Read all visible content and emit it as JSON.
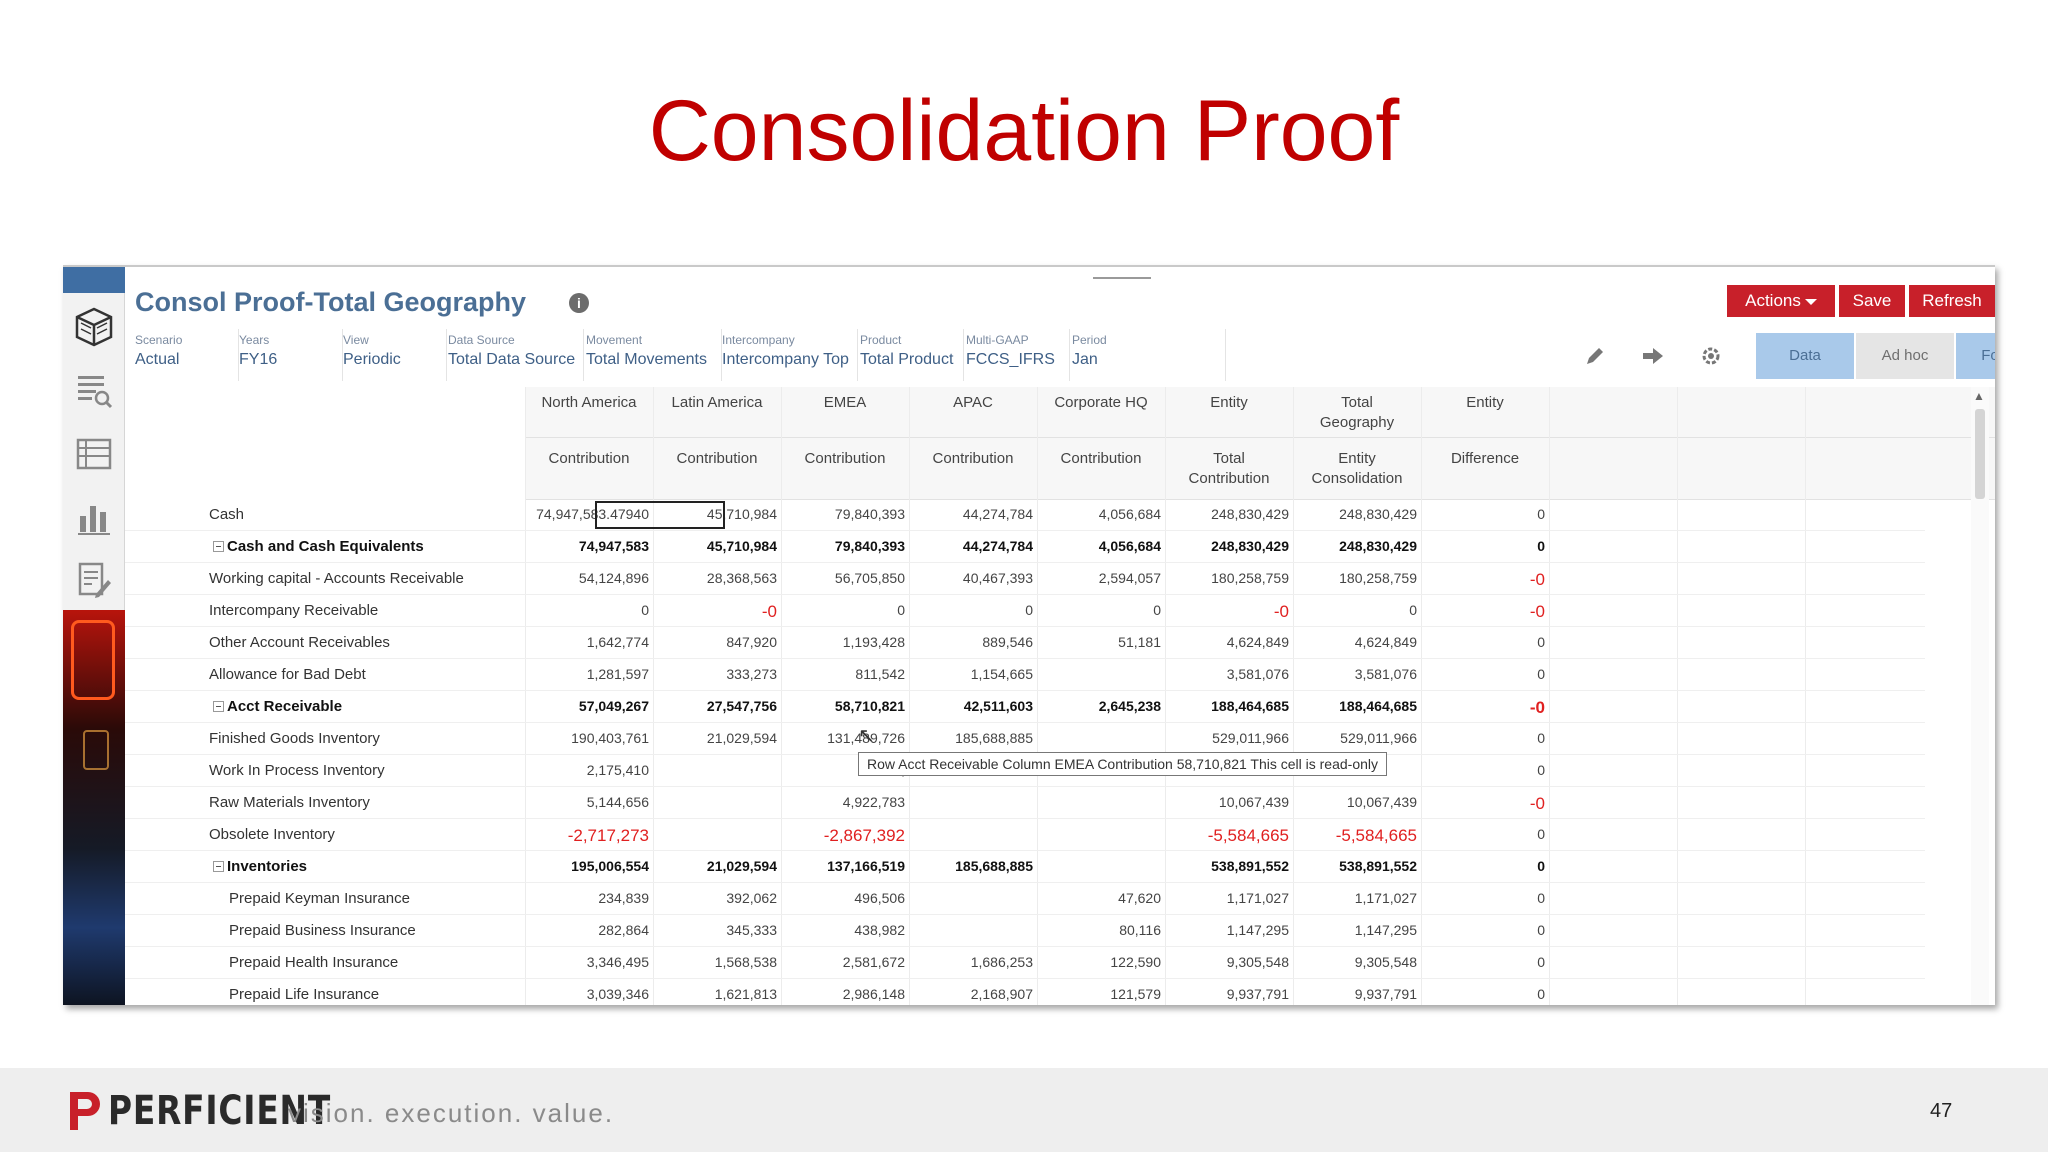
{
  "slide": {
    "title": "Consolidation Proof",
    "page_number": "47"
  },
  "form": {
    "title": "Consol Proof-Total Geography",
    "info_glyph": "i",
    "actions_label": "Actions",
    "save_label": "Save",
    "refresh_label": "Refresh",
    "tabs": {
      "data": "Data",
      "adhoc": "Ad hoc",
      "format": "Format"
    }
  },
  "pov": [
    {
      "label": "Scenario",
      "value": "Actual"
    },
    {
      "label": "Years",
      "value": "FY16"
    },
    {
      "label": "View",
      "value": "Periodic"
    },
    {
      "label": "Data Source",
      "value": "Total Data Source"
    },
    {
      "label": "Movement",
      "value": "Total Movements"
    },
    {
      "label": "Intercompany",
      "value": "Intercompany Top"
    },
    {
      "label": "Product",
      "value": "Total Product"
    },
    {
      "label": "Multi-GAAP",
      "value": "FCCS_IFRS"
    },
    {
      "label": "Period",
      "value": "Jan"
    }
  ],
  "columns": [
    {
      "h1": "North America",
      "h1b": "",
      "h2": "Contribution",
      "h2b": ""
    },
    {
      "h1": "Latin America",
      "h1b": "",
      "h2": "Contribution",
      "h2b": ""
    },
    {
      "h1": "EMEA",
      "h1b": "",
      "h2": "Contribution",
      "h2b": ""
    },
    {
      "h1": "APAC",
      "h1b": "",
      "h2": "Contribution",
      "h2b": ""
    },
    {
      "h1": "Corporate HQ",
      "h1b": "",
      "h2": "Contribution",
      "h2b": ""
    },
    {
      "h1": "Entity",
      "h1b": "",
      "h2": "Total",
      "h2b": "Contribution"
    },
    {
      "h1": "Total",
      "h1b": "Geography",
      "h2": "Entity",
      "h2b": "Consolidation"
    },
    {
      "h1": "Entity",
      "h1b": "",
      "h2": "Difference",
      "h2b": ""
    }
  ],
  "rows": [
    {
      "label": "Cash",
      "bold": false,
      "indent": 1,
      "expander": false,
      "values": [
        "74,947,583.47940",
        "45,710,984",
        "79,840,393",
        "44,274,784",
        "4,056,684",
        "248,830,429",
        "248,830,429",
        "0"
      ]
    },
    {
      "label": "Cash and Cash Equivalents",
      "bold": true,
      "indent": 0,
      "expander": true,
      "values": [
        "74,947,583",
        "45,710,984",
        "79,840,393",
        "44,274,784",
        "4,056,684",
        "248,830,429",
        "248,830,429",
        "0"
      ]
    },
    {
      "label": "Working capital - Accounts Receivable",
      "bold": false,
      "indent": 1,
      "expander": false,
      "values": [
        "54,124,896",
        "28,368,563",
        "56,705,850",
        "40,467,393",
        "2,594,057",
        "180,258,759",
        "180,258,759",
        "-0"
      ]
    },
    {
      "label": "Intercompany Receivable",
      "bold": false,
      "indent": 1,
      "expander": false,
      "values": [
        "0",
        "-0",
        "0",
        "0",
        "0",
        "-0",
        "0",
        "-0"
      ]
    },
    {
      "label": "Other Account Receivables",
      "bold": false,
      "indent": 1,
      "expander": false,
      "values": [
        "1,642,774",
        "847,920",
        "1,193,428",
        "889,546",
        "51,181",
        "4,624,849",
        "4,624,849",
        "0"
      ]
    },
    {
      "label": "Allowance for Bad Debt",
      "bold": false,
      "indent": 1,
      "expander": false,
      "values": [
        "1,281,597",
        "333,273",
        "811,542",
        "1,154,665",
        "",
        "3,581,076",
        "3,581,076",
        "0"
      ]
    },
    {
      "label": "Acct Receivable",
      "bold": true,
      "indent": 0,
      "expander": true,
      "values": [
        "57,049,267",
        "27,547,756",
        "58,710,821",
        "42,511,603",
        "2,645,238",
        "188,464,685",
        "188,464,685",
        "-0"
      ]
    },
    {
      "label": "Finished Goods Inventory",
      "bold": false,
      "indent": 1,
      "expander": false,
      "values": [
        "190,403,761",
        "21,029,594",
        "131,489,726",
        "185,688,885",
        "",
        "529,011,966",
        "529,011,966",
        "0"
      ]
    },
    {
      "label": "Work In Process Inventory",
      "bold": false,
      "indent": 1,
      "expander": false,
      "values": [
        "2,175,410",
        "",
        "3,",
        "",
        "",
        "",
        "",
        "0"
      ]
    },
    {
      "label": "Raw Materials Inventory",
      "bold": false,
      "indent": 1,
      "expander": false,
      "values": [
        "5,144,656",
        "",
        "4,922,783",
        "",
        "",
        "10,067,439",
        "10,067,439",
        "-0"
      ]
    },
    {
      "label": "Obsolete Inventory",
      "bold": false,
      "indent": 1,
      "expander": false,
      "values": [
        "-2,717,273",
        "",
        "-2,867,392",
        "",
        "",
        "-5,584,665",
        "-5,584,665",
        "0"
      ]
    },
    {
      "label": "Inventories",
      "bold": true,
      "indent": 0,
      "expander": true,
      "values": [
        "195,006,554",
        "21,029,594",
        "137,166,519",
        "185,688,885",
        "",
        "538,891,552",
        "538,891,552",
        "0"
      ]
    },
    {
      "label": "Prepaid Keyman Insurance",
      "bold": false,
      "indent": 2,
      "expander": false,
      "values": [
        "234,839",
        "392,062",
        "496,506",
        "",
        "47,620",
        "1,171,027",
        "1,171,027",
        "0"
      ]
    },
    {
      "label": "Prepaid Business Insurance",
      "bold": false,
      "indent": 2,
      "expander": false,
      "values": [
        "282,864",
        "345,333",
        "438,982",
        "",
        "80,116",
        "1,147,295",
        "1,147,295",
        "0"
      ]
    },
    {
      "label": "Prepaid Health Insurance",
      "bold": false,
      "indent": 2,
      "expander": false,
      "values": [
        "3,346,495",
        "1,568,538",
        "2,581,672",
        "1,686,253",
        "122,590",
        "9,305,548",
        "9,305,548",
        "0"
      ]
    },
    {
      "label": "Prepaid Life Insurance",
      "bold": false,
      "indent": 2,
      "expander": false,
      "values": [
        "3,039,346",
        "1,621,813",
        "2,986,148",
        "2,168,907",
        "121,579",
        "9,937,791",
        "9,937,791",
        "0"
      ]
    }
  ],
  "tooltip": "Row Acct Receivable Column EMEA Contribution 58,710,821  This cell is read-only",
  "footer": {
    "logo": "PERFICIENT",
    "tagline": "vision.  execution.  value."
  },
  "colors": {
    "title_red": "#c00000",
    "form_blue": "#4b6f95",
    "button_red": "#c8202a",
    "negative_red": "#e02020",
    "tab_blue": "#a9c9ea"
  },
  "icons": [
    "grid-cube-icon",
    "report-search-icon",
    "list-icon",
    "bar-chart-icon",
    "form-edit-icon",
    "pencil-icon",
    "arrow-right-icon",
    "gear-icon",
    "info-icon",
    "scroll-up-icon"
  ]
}
